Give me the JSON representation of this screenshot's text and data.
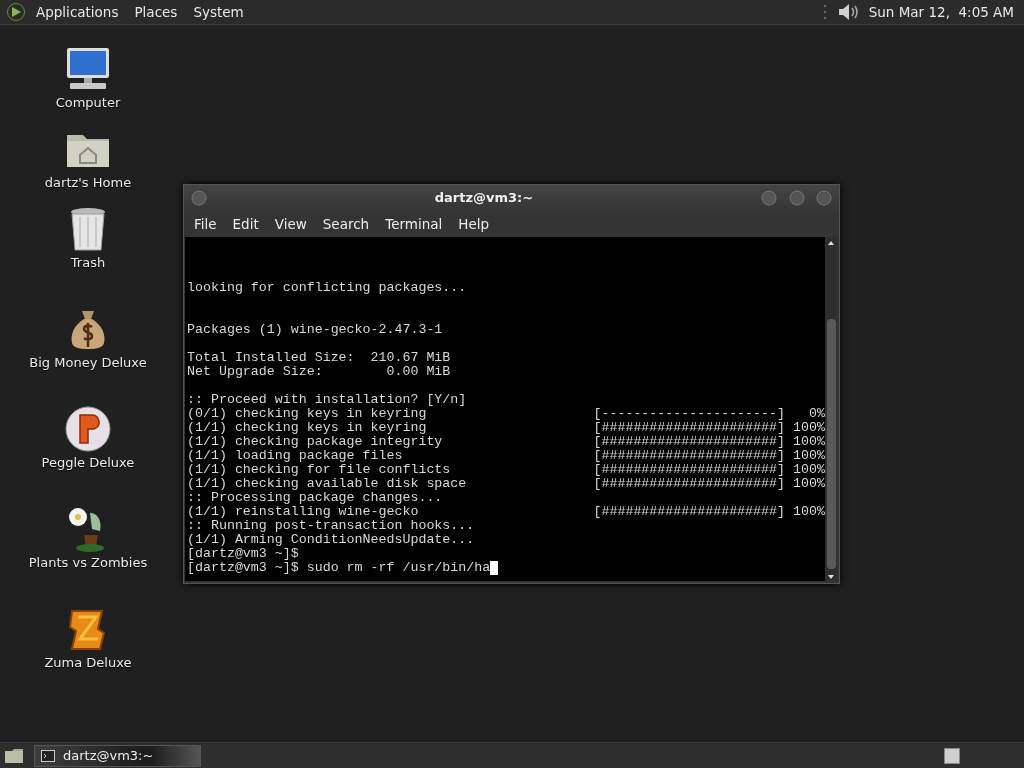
{
  "top_panel": {
    "menus": [
      "Applications",
      "Places",
      "System"
    ],
    "clock": "Sun Mar 12,  4:05 AM"
  },
  "desktop_icons": [
    {
      "label": "Computer",
      "kind": "computer"
    },
    {
      "label": "dartz's Home",
      "kind": "folder"
    },
    {
      "label": "Trash",
      "kind": "trash"
    }
  ],
  "game_icons": [
    {
      "label": "Big Money Deluxe",
      "kind": "moneybag"
    },
    {
      "label": "Peggle Deluxe",
      "kind": "ball"
    },
    {
      "label": "Plants vs Zombies",
      "kind": "plant"
    },
    {
      "label": "Zuma Deluxe",
      "kind": "block"
    }
  ],
  "terminal": {
    "title": "dartz@vm3:~",
    "menus": [
      "File",
      "Edit",
      "View",
      "Search",
      "Terminal",
      "Help"
    ],
    "lines": [
      {
        "kind": "text",
        "text": "looking for conflicting packages..."
      },
      {
        "kind": "blank"
      },
      {
        "kind": "blank"
      },
      {
        "kind": "text",
        "text": "Packages (1) wine-gecko-2.47.3-1"
      },
      {
        "kind": "blank"
      },
      {
        "kind": "text",
        "text": "Total Installed Size:  210.67 MiB"
      },
      {
        "kind": "text",
        "text": "Net Upgrade Size:        0.00 MiB"
      },
      {
        "kind": "blank"
      },
      {
        "kind": "text",
        "text": ":: Proceed with installation? [Y/n]"
      },
      {
        "kind": "progress",
        "text": "(0/1) checking keys in keyring",
        "bar": "[----------------------]",
        "percent": "0%"
      },
      {
        "kind": "progress",
        "text": "(1/1) checking keys in keyring",
        "bar": "[######################]",
        "percent": "100%"
      },
      {
        "kind": "progress",
        "text": "(1/1) checking package integrity",
        "bar": "[######################]",
        "percent": "100%"
      },
      {
        "kind": "progress",
        "text": "(1/1) loading package files",
        "bar": "[######################]",
        "percent": "100%"
      },
      {
        "kind": "progress",
        "text": "(1/1) checking for file conflicts",
        "bar": "[######################]",
        "percent": "100%"
      },
      {
        "kind": "progress",
        "text": "(1/1) checking available disk space",
        "bar": "[######################]",
        "percent": "100%"
      },
      {
        "kind": "text",
        "text": ":: Processing package changes..."
      },
      {
        "kind": "progress",
        "text": "(1/1) reinstalling wine-gecko",
        "bar": "[######################]",
        "percent": "100%"
      },
      {
        "kind": "text",
        "text": ":: Running post-transaction hooks..."
      },
      {
        "kind": "text",
        "text": "(1/1) Arming ConditionNeedsUpdate..."
      },
      {
        "kind": "prompt",
        "text": "[dartz@vm3 ~]$"
      },
      {
        "kind": "prompt",
        "text": "[dartz@vm3 ~]$ sudo rm -rf /usr/bin/ha",
        "cursor": true
      }
    ]
  },
  "bottom_panel": {
    "tasks": [
      {
        "label": "dartz@vm3:~",
        "selected": true
      }
    ]
  }
}
